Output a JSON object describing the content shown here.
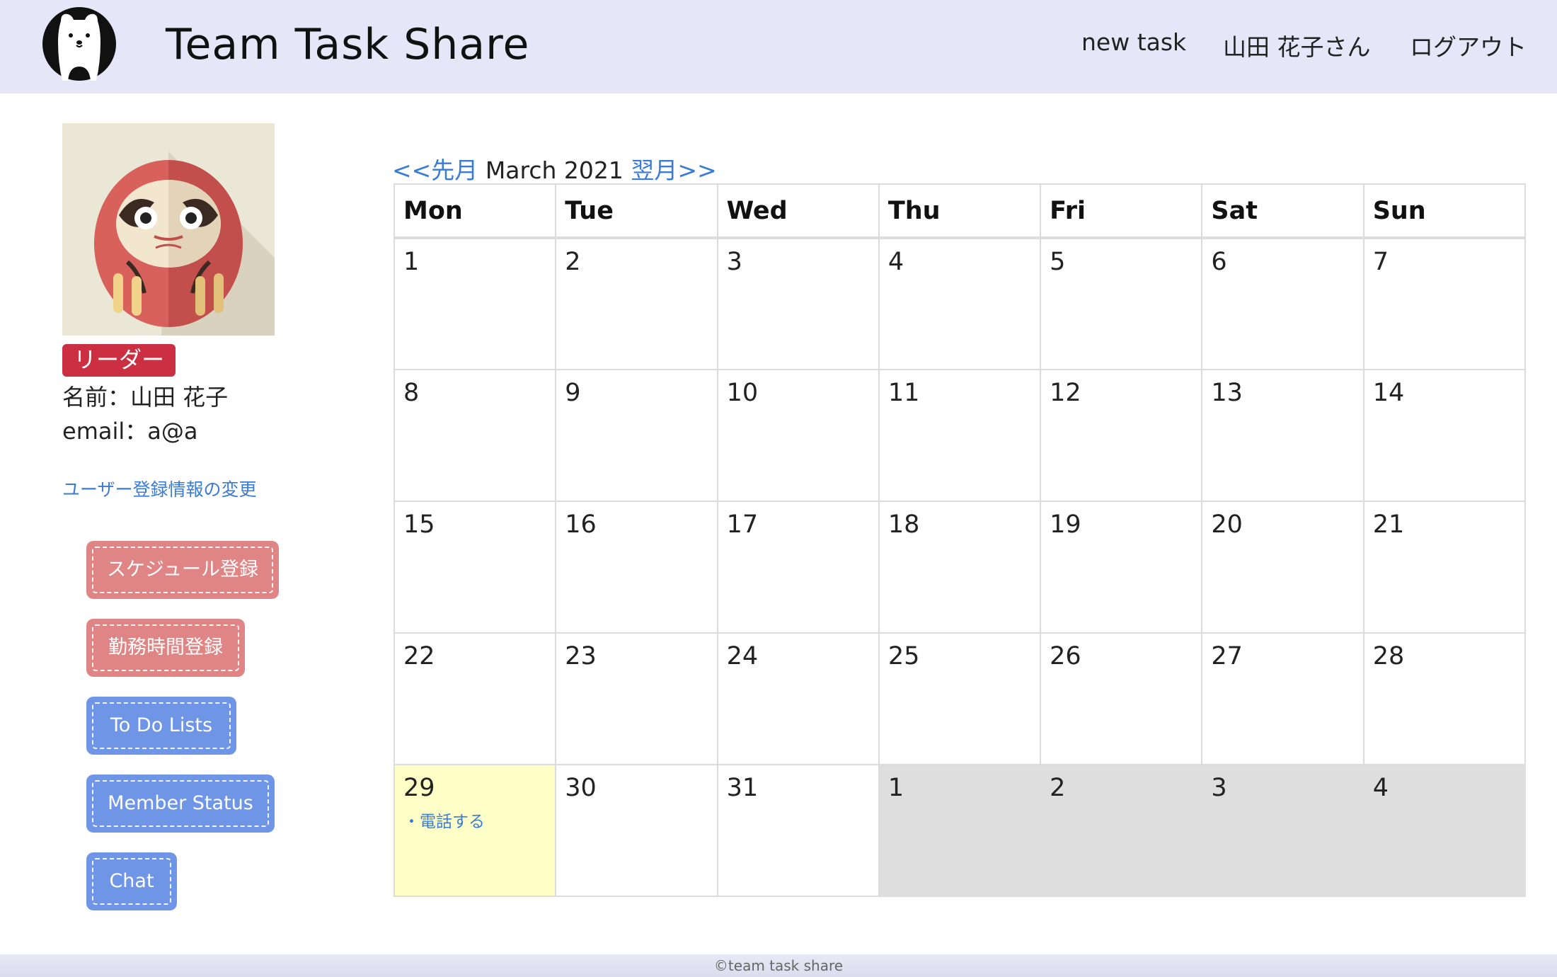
{
  "header": {
    "title": "Team Task Share",
    "nav": {
      "new_task": "new task",
      "user": "山田 花子さん",
      "logout": "ログアウト"
    },
    "logo_icon": "polar-bear-icon",
    "background": "#e6e6f8"
  },
  "profile": {
    "avatar_icon": "daruma-icon",
    "role": "リーダー",
    "name_line": "名前：山田 花子",
    "email_line": "email：a@a",
    "edit_link": "ユーザー登録情報の変更"
  },
  "sidebar": {
    "buttons": [
      {
        "label": "スケジュール登録",
        "color": "#e08585"
      },
      {
        "label": "勤務時間登録",
        "color": "#e08585"
      },
      {
        "label": "To Do Lists",
        "color": "#6f95e6"
      },
      {
        "label": "Member Status",
        "color": "#6f95e6"
      },
      {
        "label": "Chat",
        "color": "#6f95e6"
      }
    ]
  },
  "calendar": {
    "prev_label": "<<先月",
    "month_label": "March 2021",
    "next_label": "翌月>>",
    "weekdays": [
      "Mon",
      "Tue",
      "Wed",
      "Thu",
      "Fri",
      "Sat",
      "Sun"
    ],
    "weeks": [
      [
        {
          "day": "1"
        },
        {
          "day": "2"
        },
        {
          "day": "3"
        },
        {
          "day": "4"
        },
        {
          "day": "5"
        },
        {
          "day": "6"
        },
        {
          "day": "7"
        }
      ],
      [
        {
          "day": "8"
        },
        {
          "day": "9"
        },
        {
          "day": "10"
        },
        {
          "day": "11"
        },
        {
          "day": "12"
        },
        {
          "day": "13"
        },
        {
          "day": "14"
        }
      ],
      [
        {
          "day": "15"
        },
        {
          "day": "16"
        },
        {
          "day": "17"
        },
        {
          "day": "18"
        },
        {
          "day": "19"
        },
        {
          "day": "20"
        },
        {
          "day": "21"
        }
      ],
      [
        {
          "day": "22"
        },
        {
          "day": "23"
        },
        {
          "day": "24"
        },
        {
          "day": "25"
        },
        {
          "day": "26"
        },
        {
          "day": "27"
        },
        {
          "day": "28"
        }
      ],
      [
        {
          "day": "29",
          "today": true,
          "task": "・電話する"
        },
        {
          "day": "30"
        },
        {
          "day": "31"
        },
        {
          "day": "1",
          "other_month": true
        },
        {
          "day": "2",
          "other_month": true
        },
        {
          "day": "3",
          "other_month": true
        },
        {
          "day": "4",
          "other_month": true
        }
      ]
    ],
    "today_color": "#ffffc8",
    "other_month_color": "#dedede"
  },
  "footer": {
    "text": "©team task share"
  }
}
